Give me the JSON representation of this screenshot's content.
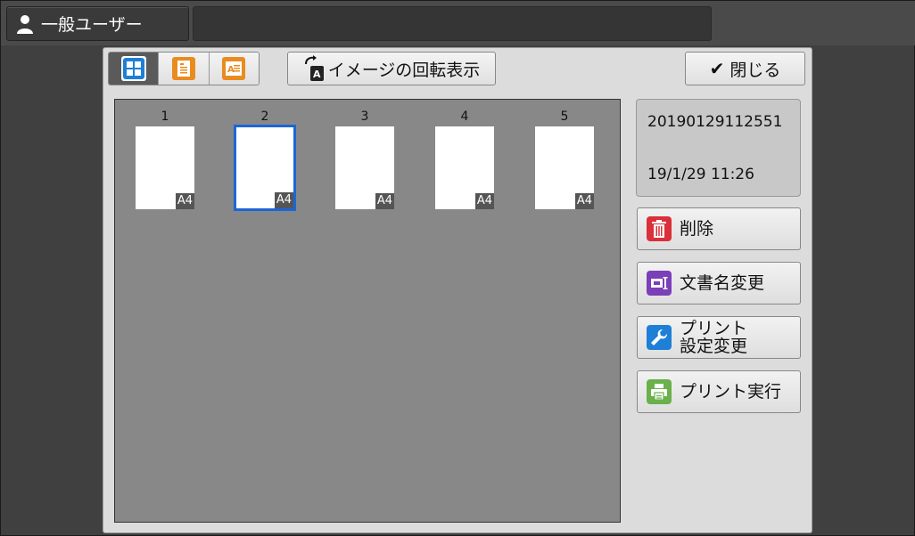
{
  "header": {
    "user_label": "一般ユーザー",
    "message": ""
  },
  "toolbar": {
    "view_modes": [
      "thumbnail-grid-icon",
      "document-list-icon",
      "document-detail-icon"
    ],
    "active_view_mode": 0,
    "rotate_label": "イメージの回転表示",
    "close_label": "閉じる"
  },
  "pages": [
    {
      "number": "1",
      "size": "A4"
    },
    {
      "number": "2",
      "size": "A4"
    },
    {
      "number": "3",
      "size": "A4"
    },
    {
      "number": "4",
      "size": "A4"
    },
    {
      "number": "5",
      "size": "A4"
    }
  ],
  "selected_page": "2",
  "document": {
    "name": "20190129112551",
    "datetime": "19/1/29 11:26"
  },
  "actions": {
    "delete_label": "削除",
    "rename_label": "文書名変更",
    "print_settings_line1": "プリント",
    "print_settings_line2": "設定変更",
    "print_label": "プリント実行"
  },
  "colors": {
    "selected_border": "#1a66d8",
    "delete_icon": "#d9303a",
    "rename_icon": "#7b3fb8",
    "settings_icon": "#1e7fd6",
    "print_icon": "#6ab04c",
    "doc_icon": "#e98b1f"
  }
}
